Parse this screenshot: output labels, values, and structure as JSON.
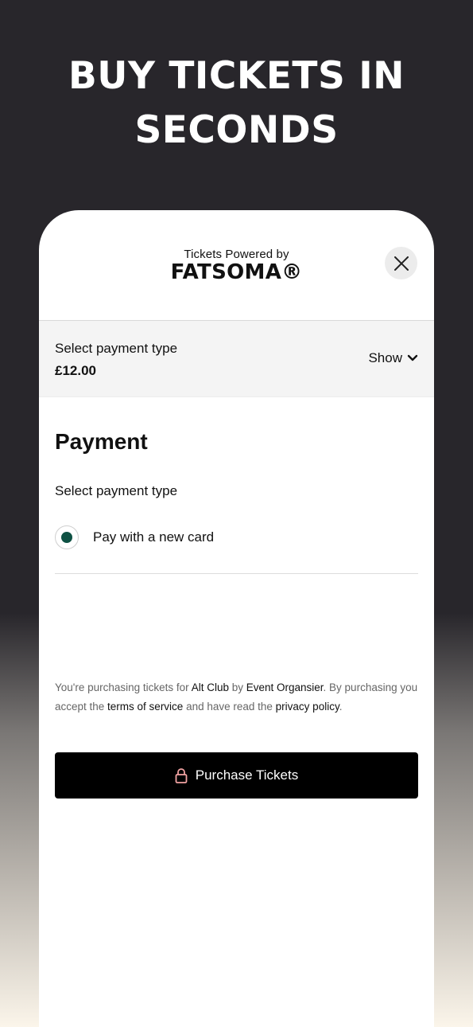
{
  "promo": {
    "title_line1": "BUY TICKETS IN",
    "title_line2": "SECONDS"
  },
  "header": {
    "powered_by": "Tickets Powered by",
    "brand": "FATSOMA®",
    "close_icon": "close-icon"
  },
  "summary": {
    "label": "Select payment type",
    "price": "£12.00",
    "toggle_label": "Show",
    "toggle_icon": "chevron-down-icon"
  },
  "payment": {
    "heading": "Payment",
    "subheading": "Select payment type",
    "options": [
      {
        "label": "Pay with a new card",
        "selected": true
      }
    ]
  },
  "terms": {
    "part1": "You're purchasing tickets for ",
    "event": "Alt Club",
    "part2": " by ",
    "organiser": "Event Organsier",
    "part3": ". By purchasing you accept the ",
    "tos": "terms of service",
    "part4": " and have read the ",
    "privacy": "privacy policy",
    "part5": "."
  },
  "purchase": {
    "label": "Purchase Tickets",
    "icon": "lock-icon"
  },
  "colors": {
    "background_dark": "#28262b",
    "background_light": "#fbf5ea",
    "radio_selected": "#0e5143",
    "lock_icon": "#f2a3a3",
    "button": "#000000"
  }
}
